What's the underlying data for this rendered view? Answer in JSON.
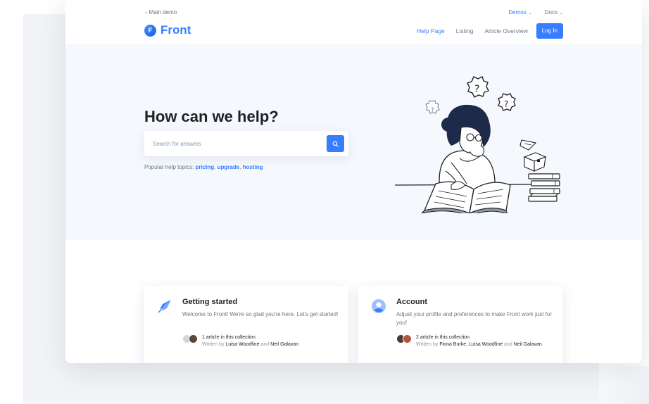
{
  "topbar": {
    "back_label": "Main demo",
    "demos_label": "Demos",
    "docs_label": "Docs"
  },
  "brand": {
    "name": "Front",
    "mark": "F"
  },
  "nav": {
    "items": [
      "Help Page",
      "Listing",
      "Article Overview"
    ],
    "login": "Log In"
  },
  "hero": {
    "title": "How can we help?",
    "search_placeholder": "Search for answers",
    "topics_label": "Popular help topics:",
    "topics": [
      "pricing",
      "upgrade",
      "hosting"
    ]
  },
  "cards": [
    {
      "title": "Getting started",
      "description": "Welcome to Front! We're so glad you're here. Let's get started!",
      "count": "1 article in this collection",
      "written_by": "Written by",
      "authors": "Luisa Woodfine",
      "and": "and",
      "last_author": "Neil Galavan"
    },
    {
      "title": "Account",
      "description": "Adjust your profile and preferences to make Front work just for you!",
      "count": "2 article in this collection",
      "written_by": "Written by",
      "authors": "Fiona Burke, Luisa Woodfine",
      "and": "and",
      "last_author": "Neil Galavan"
    }
  ],
  "colors": {
    "accent": "#377dff",
    "hero_bg": "#f5f9fe",
    "text_muted": "#677788",
    "text_dark": "#1e2022"
  }
}
